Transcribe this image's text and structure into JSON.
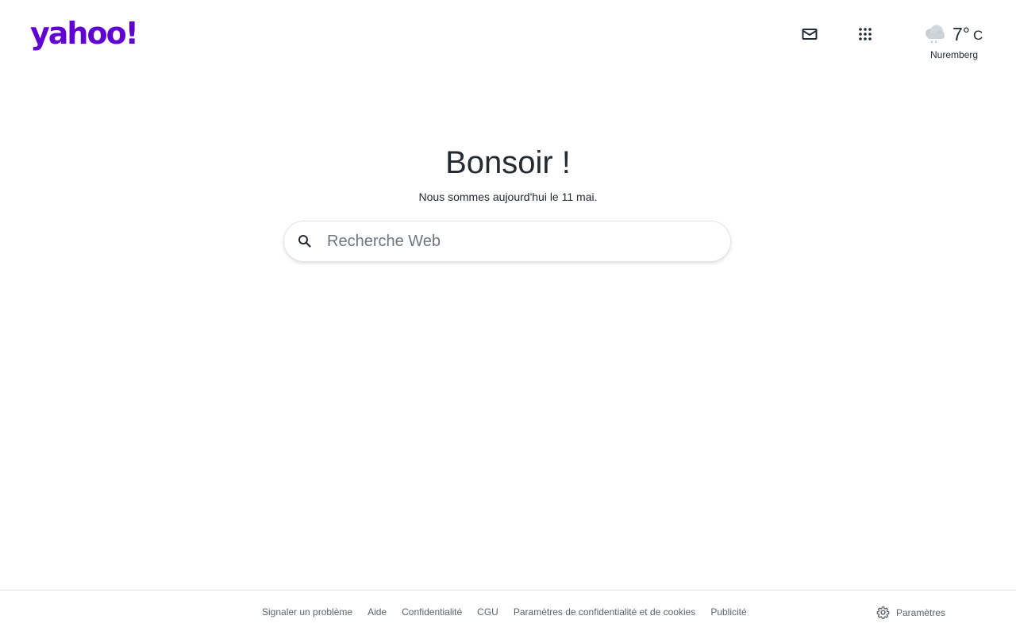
{
  "brand": {
    "logo_text": "yahoo!",
    "color": "#6001d2"
  },
  "header": {
    "mail_icon": "mail-icon",
    "apps_icon": "apps-grid-icon",
    "weather": {
      "icon": "rain-cloud-icon",
      "temperature": "7°",
      "unit": "C",
      "city": "Nuremberg"
    }
  },
  "main": {
    "greeting": "Bonsoir !",
    "date_line": "Nous sommes aujourd'hui le 11 mai.",
    "search": {
      "icon": "search-icon",
      "placeholder": "Recherche Web",
      "value": ""
    }
  },
  "footer": {
    "links": [
      "Signaler un problème",
      "Aide",
      "Confidentialité",
      "CGU",
      "Paramètres de confidentialité et de cookies",
      "Publicité"
    ],
    "settings": {
      "icon": "gear-icon",
      "label": "Paramètres"
    }
  }
}
